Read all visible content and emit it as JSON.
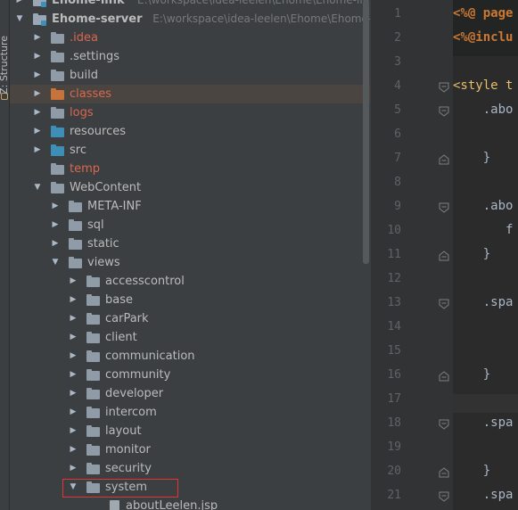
{
  "toolstrip": {
    "label": "Z: Structure",
    "icon": "structure-icon"
  },
  "tree": {
    "rows": [
      {
        "label": "Ehome-link",
        "path": "E:\\workspace\\idea-leelen\\Ehome\\Ehome-link",
        "kind": "module",
        "expanded": false,
        "bold": true
      },
      {
        "label": "Ehome-server",
        "path": "E:\\workspace\\idea-leelen\\Ehome\\Ehome-server",
        "kind": "module",
        "expanded": true,
        "bold": true
      },
      {
        "label": ".idea",
        "kind": "folder",
        "color": "red",
        "expanded": false
      },
      {
        "label": ".settings",
        "kind": "folder",
        "expanded": false
      },
      {
        "label": "build",
        "kind": "folder",
        "expanded": false
      },
      {
        "label": "classes",
        "kind": "folder-orange",
        "color": "red",
        "expanded": false
      },
      {
        "label": "logs",
        "kind": "folder",
        "color": "red",
        "expanded": false
      },
      {
        "label": "resources",
        "kind": "folder-blue",
        "expanded": false
      },
      {
        "label": "src",
        "kind": "folder-blue",
        "expanded": false
      },
      {
        "label": "temp",
        "kind": "folder",
        "color": "red",
        "expanded": null
      },
      {
        "label": "WebContent",
        "kind": "folder",
        "expanded": true
      },
      {
        "label": "META-INF",
        "kind": "folder",
        "expanded": false
      },
      {
        "label": "sql",
        "kind": "folder",
        "expanded": false
      },
      {
        "label": "static",
        "kind": "folder",
        "expanded": false
      },
      {
        "label": "views",
        "kind": "folder",
        "expanded": true
      },
      {
        "label": "accesscontrol",
        "kind": "folder",
        "expanded": false
      },
      {
        "label": "base",
        "kind": "folder",
        "expanded": false
      },
      {
        "label": "carPark",
        "kind": "folder",
        "expanded": false
      },
      {
        "label": "client",
        "kind": "folder",
        "expanded": false
      },
      {
        "label": "communication",
        "kind": "folder",
        "expanded": false
      },
      {
        "label": "community",
        "kind": "folder",
        "expanded": false
      },
      {
        "label": "developer",
        "kind": "folder",
        "expanded": false
      },
      {
        "label": "intercom",
        "kind": "folder",
        "expanded": false
      },
      {
        "label": "layout",
        "kind": "folder",
        "expanded": false
      },
      {
        "label": "monitor",
        "kind": "folder",
        "expanded": false
      },
      {
        "label": "security",
        "kind": "folder",
        "expanded": false
      },
      {
        "label": "system",
        "kind": "folder",
        "expanded": true,
        "selected": true
      },
      {
        "label": "aboutLeelen.jsp",
        "kind": "file",
        "expanded": null
      }
    ]
  },
  "editor": {
    "lines": [
      {
        "n": "1",
        "code": "<%@ page"
      },
      {
        "n": "2",
        "code": "<%@inclu"
      },
      {
        "n": "3",
        "code": ""
      },
      {
        "n": "4",
        "code": "<style t"
      },
      {
        "n": "5",
        "code": "    .abo"
      },
      {
        "n": "6",
        "code": ""
      },
      {
        "n": "7",
        "code": "    }"
      },
      {
        "n": "8",
        "code": ""
      },
      {
        "n": "9",
        "code": "    .abo"
      },
      {
        "n": "10",
        "code": "       f"
      },
      {
        "n": "11",
        "code": "    }"
      },
      {
        "n": "12",
        "code": ""
      },
      {
        "n": "13",
        "code": "    .spa"
      },
      {
        "n": "14",
        "code": ""
      },
      {
        "n": "15",
        "code": ""
      },
      {
        "n": "16",
        "code": "    }"
      },
      {
        "n": "17",
        "code": ""
      },
      {
        "n": "18",
        "code": "    .spa"
      },
      {
        "n": "19",
        "code": ""
      },
      {
        "n": "20",
        "code": "    }"
      },
      {
        "n": "21",
        "code": "    .spa"
      }
    ]
  },
  "colors": {
    "panel_bg": "#3c3f41",
    "editor_bg": "#2b2b2b",
    "gutter_bg": "#313335",
    "excluded_text": "#d9674e",
    "selection_outline": "#e03535"
  }
}
